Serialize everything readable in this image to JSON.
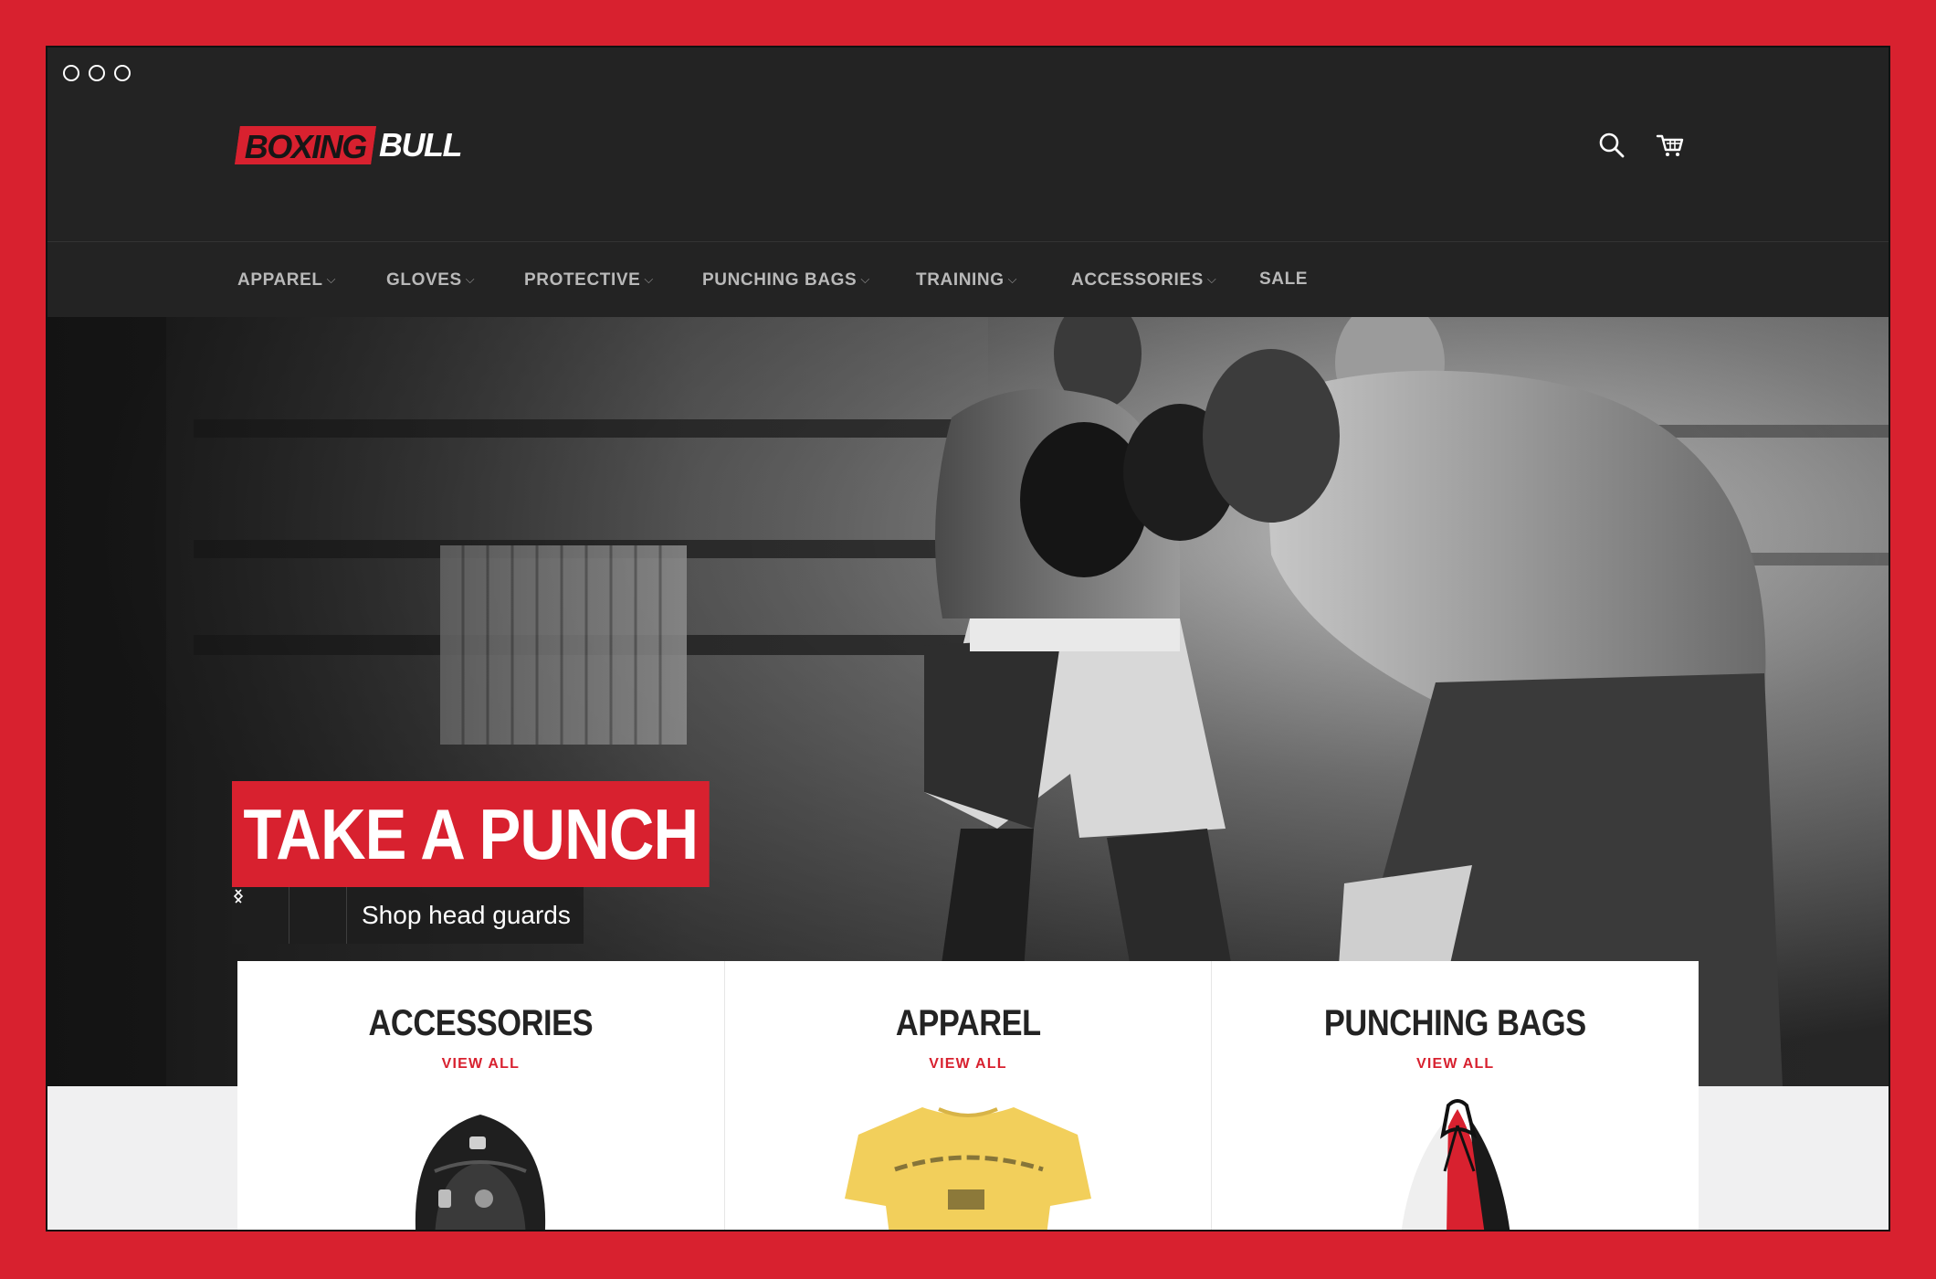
{
  "brand": {
    "logo_part1": "BOXING",
    "logo_part2": "BULL",
    "accent_color": "#d8212f",
    "dark_color": "#232323"
  },
  "window_controls": [
    "close",
    "minimize",
    "maximize"
  ],
  "header": {
    "icons": [
      "search-icon",
      "cart-icon"
    ]
  },
  "nav": {
    "items": [
      {
        "label": "APPAREL",
        "has_dropdown": true
      },
      {
        "label": "GLOVES",
        "has_dropdown": true
      },
      {
        "label": "PROTECTIVE",
        "has_dropdown": true
      },
      {
        "label": "PUNCHING BAGS",
        "has_dropdown": true
      },
      {
        "label": "TRAINING",
        "has_dropdown": true
      },
      {
        "label": "ACCESSORIES",
        "has_dropdown": true
      },
      {
        "label": "SALE",
        "has_dropdown": false
      }
    ],
    "chevron": "⌵"
  },
  "hero": {
    "title": "TAKE A PUNCH",
    "link_label": "Shop head guards",
    "prev_icon": "chevron-left-icon",
    "next_icon": "chevron-right-icon"
  },
  "collections": [
    {
      "title": "ACCESSORIES",
      "link": "VIEW ALL",
      "image": "backpack"
    },
    {
      "title": "APPAREL",
      "link": "VIEW ALL",
      "image": "yellow-tshirt"
    },
    {
      "title": "PUNCHING BAGS",
      "link": "VIEW ALL",
      "image": "punching-bag"
    }
  ]
}
